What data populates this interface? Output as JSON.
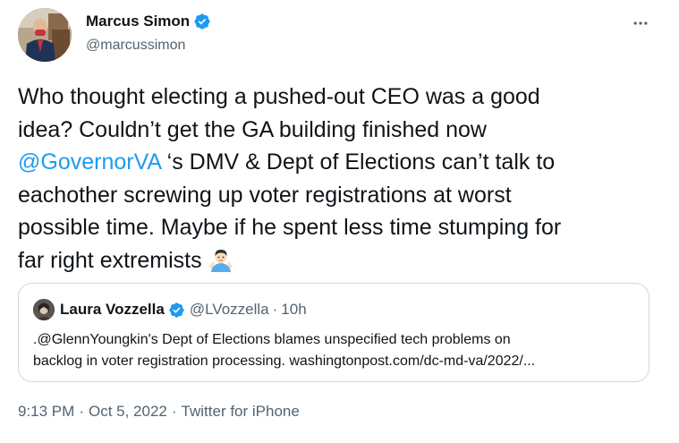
{
  "author": {
    "display_name": "Marcus Simon",
    "handle": "@marcussimon",
    "verified_icon": "verified-badge-icon",
    "avatar": "avatar-photo"
  },
  "menu_icon": "more-horizontal-icon",
  "tweet": {
    "line1": "Who thought electing a pushed-out CEO was a good",
    "line2": "idea? Couldn’t get the GA building finished now",
    "mention": "@GovernorVA",
    "line3_rest": " ‘s DMV & Dept of Elections can’t talk to",
    "line4": "eachother screwing up voter registrations at worst",
    "line5": "possible time. Maybe if he spent less time stumping for",
    "line6": "far right extremists",
    "emoji": "man-shrugging-emoji"
  },
  "quoted_tweet": {
    "display_name": "Laura Vozzella",
    "handle": "@LVozzella",
    "separator": "·",
    "time": "10h",
    "line1": ".@GlennYoungkin's Dept of Elections blames unspecified tech problems on",
    "line2": "backlog in voter registration processing. washingtonpost.com/dc-md-va/2022/..."
  },
  "footer": {
    "time": "9:13 PM",
    "sep1": "·",
    "date": "Oct 5, 2022",
    "sep2": "·",
    "source": "Twitter for iPhone"
  },
  "colors": {
    "link": "#1d9bf0",
    "secondary_text": "#536471",
    "border": "#cfd9de",
    "text": "#0f1419"
  }
}
